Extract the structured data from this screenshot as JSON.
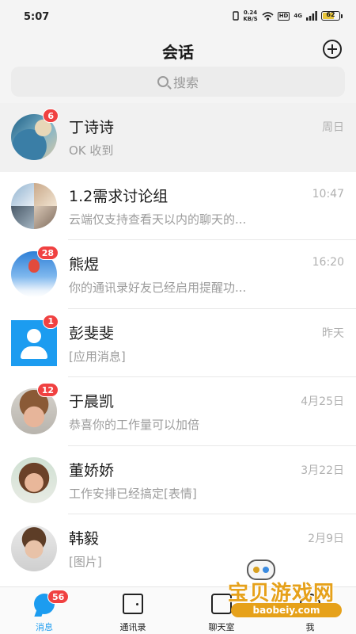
{
  "status_bar": {
    "time": "5:07",
    "net_speed_value": "0.24",
    "net_speed_unit": "KB/S",
    "hd": "HD",
    "signal": "4G",
    "battery": "62"
  },
  "header": {
    "title": "会话",
    "add_icon": "plus-circle-icon"
  },
  "search": {
    "placeholder": "搜索",
    "icon": "search-icon"
  },
  "conversations": [
    {
      "name": "丁诗诗",
      "preview": "OK 收到",
      "time": "周日",
      "badge": "6",
      "pinned": true
    },
    {
      "name": "1.2需求讨论组",
      "preview": "云端仅支持查看天以内的聊天的...",
      "time": "10:47",
      "badge": "",
      "pinned": false
    },
    {
      "name": "熊煜",
      "preview": "你的通讯录好友已经启用提醒功...",
      "time": "16:20",
      "badge": "28",
      "pinned": false
    },
    {
      "name": "彭斐斐",
      "preview": "[应用消息]",
      "time": "昨天",
      "badge": "1",
      "pinned": false
    },
    {
      "name": "于晨凯",
      "preview": "恭喜你的工作量可以加倍",
      "time": "4月25日",
      "badge": "12",
      "pinned": false
    },
    {
      "name": "董娇娇",
      "preview": "工作安排已经搞定[表情]",
      "time": "3月22日",
      "badge": "",
      "pinned": false
    },
    {
      "name": "韩毅",
      "preview": "[图片]",
      "time": "2月9日",
      "badge": "",
      "pinned": false
    }
  ],
  "bottom_nav": {
    "items": [
      {
        "label": "消息",
        "icon": "message-bubble-icon",
        "active": true,
        "badge": "56"
      },
      {
        "label": "通讯录",
        "icon": "contacts-book-icon",
        "active": false
      },
      {
        "label": "聊天室",
        "icon": "chat-room-icon",
        "active": false
      },
      {
        "label": "我",
        "icon": "profile-icon",
        "active": false
      }
    ]
  },
  "watermark": {
    "title": "宝贝游戏网",
    "url": "baobeiy.com"
  },
  "colors": {
    "accent": "#1c9cf0",
    "badge": "#f04141",
    "watermark": "#e6a11a"
  }
}
